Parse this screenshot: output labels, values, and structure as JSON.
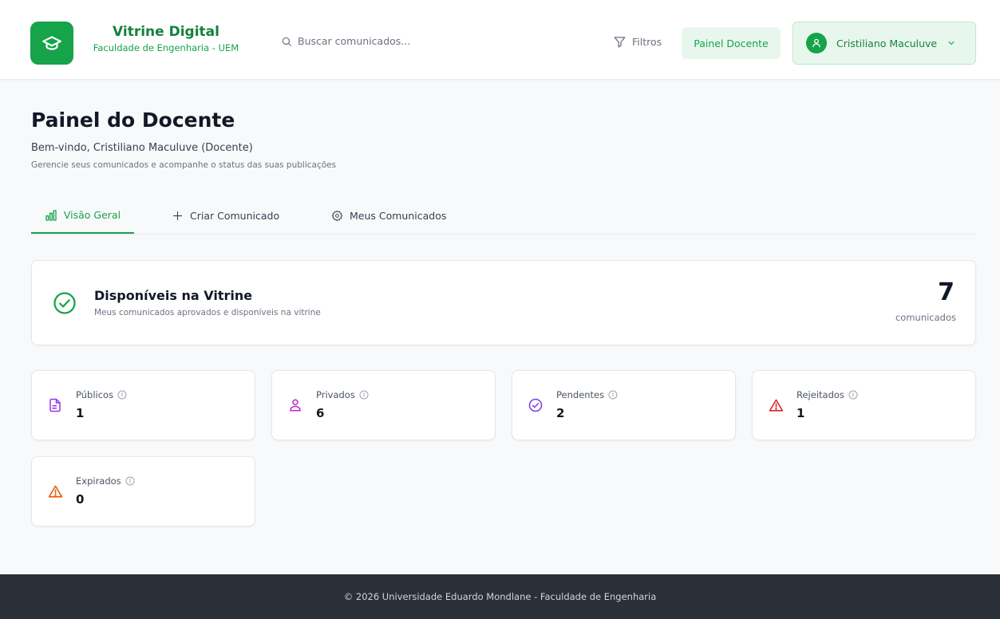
{
  "header": {
    "brand_title": "Vitrine Digital",
    "brand_subtitle": "Faculdade de Engenharia - UEM",
    "search_placeholder": "Buscar comunicados...",
    "filters_label": "Filtros",
    "panel_button_label": "Painel Docente",
    "user_name": "Cristiliano Maculuve"
  },
  "page": {
    "title": "Painel do Docente",
    "welcome": "Bem-vindo, Cristiliano Maculuve (Docente)",
    "subtitle": "Gerencie seus comunicados e acompanhe o status das suas publicações"
  },
  "tabs": [
    {
      "label": "Visão Geral",
      "icon": "bar-chart-icon",
      "active": true
    },
    {
      "label": "Criar Comunicado",
      "icon": "plus-icon",
      "active": false
    },
    {
      "label": "Meus Comunicados",
      "icon": "gear-icon",
      "active": false
    }
  ],
  "summary": {
    "title": "Disponíveis na Vitrine",
    "description": "Meus comunicados aprovados e disponíveis na vitrine",
    "count": "7",
    "unit": "comunicados",
    "icon": "check-circle-icon"
  },
  "stats": [
    {
      "label": "Públicos",
      "value": "1",
      "icon": "document-icon",
      "color": "#9333ea"
    },
    {
      "label": "Privados",
      "value": "6",
      "icon": "user-icon",
      "color": "#c026d3"
    },
    {
      "label": "Pendentes",
      "value": "2",
      "icon": "check-circle-icon",
      "color": "#7c3aed"
    },
    {
      "label": "Rejeitados",
      "value": "1",
      "icon": "alert-triangle-icon",
      "color": "#dc2626"
    },
    {
      "label": "Expirados",
      "value": "0",
      "icon": "alert-triangle-icon",
      "color": "#ea580c"
    }
  ],
  "footer": {
    "text": "© 2026 Universidade Eduardo Mondlane - Faculdade de Engenharia"
  },
  "colors": {
    "accent": "#16a34a",
    "accent_light": "#e8f7ed",
    "footer_bg": "#2b2f38"
  }
}
